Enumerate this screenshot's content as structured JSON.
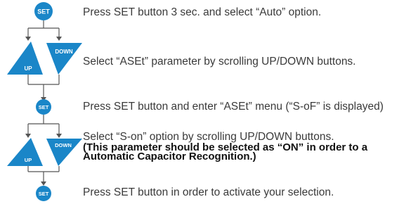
{
  "colors": {
    "accent": "#1a86c8",
    "line": "#555555"
  },
  "steps": [
    {
      "button": "SET",
      "text": "Press SET button 3 sec. and select “Auto” option."
    },
    {
      "button_up": "UP",
      "button_down": "DOWN",
      "text": "Select “ASEt” parameter by scrolling UP/DOWN buttons."
    },
    {
      "button": "SET",
      "text": "Press SET button and enter “ASEt” menu (“S-oF” is displayed)"
    },
    {
      "button_up": "UP",
      "button_down": "DOWN",
      "text": "Select “S-on” option by scrolling UP/DOWN buttons.",
      "note_line1": "(This parameter should be selected as “ON” in order to a",
      "note_line2": "Automatic Capacitor Recognition.)"
    },
    {
      "button": "SET",
      "text": "Press SET button in order to activate your selection."
    }
  ]
}
